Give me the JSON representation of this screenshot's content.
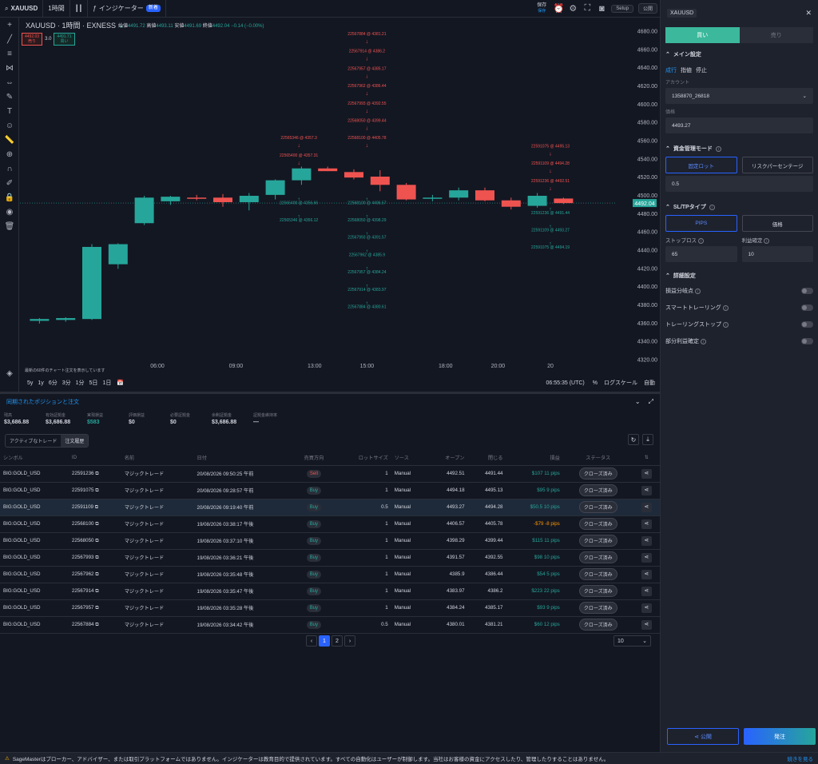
{
  "topbar": {
    "symbol": "XAUUSD",
    "interval": "1時間",
    "indicators": "インジケーター",
    "new_badge": "新着",
    "save": "保存",
    "saved": "保存",
    "setup": "Setup",
    "publish": "公開"
  },
  "chart": {
    "title": "XAUUSD · 1時間 · EXNESS",
    "ohlc": {
      "o_label": "始値",
      "o": "4491.72",
      "h_label": "高値",
      "h": "4493.11",
      "l_label": "安値",
      "l": "4491.69",
      "c_label": "終値",
      "c": "4492.04",
      "chg": "−0.14 (−0.00%)"
    },
    "sell_price": "4492.03",
    "sell_label": "売り",
    "qty": "3.0",
    "buy_price": "4491.71",
    "buy_label": "買い",
    "current_price": "4492.04",
    "show_orders_note": "最新の60件のチャート注文を表示しています",
    "timeframes": [
      "5y",
      "1y",
      "6分",
      "3分",
      "1分",
      "5日",
      "1日"
    ],
    "clock": "06:55:35 (UTC)",
    "pct": "%",
    "log": "ログスケール",
    "auto": "自動",
    "colors": {
      "up": "#26a69a",
      "down": "#ef5350"
    },
    "chart_data": {
      "type": "candlestick",
      "ylim": [
        4310,
        4690
      ],
      "yticks": [
        "4680.00",
        "4660.00",
        "4640.00",
        "4620.00",
        "4600.00",
        "4580.00",
        "4560.00",
        "4540.00",
        "4520.00",
        "4500.00",
        "4480.00",
        "4460.00",
        "4440.00",
        "4420.00",
        "4400.00",
        "4380.00",
        "4360.00",
        "4340.00",
        "4320.00"
      ],
      "xticks": [
        {
          "i": 4.5,
          "label": "06:00"
        },
        {
          "i": 7.5,
          "label": "09:00"
        },
        {
          "i": 10.5,
          "label": "13:00"
        },
        {
          "i": 12.5,
          "label": "15:00"
        },
        {
          "i": 15.5,
          "label": "18:00"
        },
        {
          "i": 17.5,
          "label": "20:00"
        },
        {
          "i": 19.5,
          "label": "20"
        }
      ],
      "candles": [
        {
          "o": 4363,
          "h": 4366,
          "l": 4360,
          "c": 4365
        },
        {
          "o": 4364,
          "h": 4367,
          "l": 4362,
          "c": 4366
        },
        {
          "o": 4365,
          "h": 4447,
          "l": 4364,
          "c": 4444
        },
        {
          "o": 4425,
          "h": 4448,
          "l": 4420,
          "c": 4447
        },
        {
          "o": 4470,
          "h": 4500,
          "l": 4468,
          "c": 4498
        },
        {
          "o": 4494,
          "h": 4500,
          "l": 4490,
          "c": 4499
        },
        {
          "o": 4498,
          "h": 4501,
          "l": 4495,
          "c": 4497
        },
        {
          "o": 4498,
          "h": 4502,
          "l": 4488,
          "c": 4493
        },
        {
          "o": 4493,
          "h": 4503,
          "l": 4484,
          "c": 4500
        },
        {
          "o": 4501,
          "h": 4518,
          "l": 4496,
          "c": 4517
        },
        {
          "o": 4517,
          "h": 4532,
          "l": 4512,
          "c": 4530
        },
        {
          "o": 4530,
          "h": 4532,
          "l": 4527,
          "c": 4527
        },
        {
          "o": 4526,
          "h": 4529,
          "l": 4518,
          "c": 4520
        },
        {
          "o": 4521,
          "h": 4528,
          "l": 4505,
          "c": 4512
        },
        {
          "o": 4512,
          "h": 4514,
          "l": 4495,
          "c": 4496
        },
        {
          "o": 4497,
          "h": 4501,
          "l": 4494,
          "c": 4498
        },
        {
          "o": 4498,
          "h": 4509,
          "l": 4495,
          "c": 4506
        },
        {
          "o": 4506,
          "h": 4509,
          "l": 4494,
          "c": 4495
        },
        {
          "o": 4495,
          "h": 4498,
          "l": 4485,
          "c": 4488
        },
        {
          "o": 4489,
          "h": 4503,
          "l": 4487,
          "c": 4500
        },
        {
          "o": 4497,
          "h": 4498,
          "l": 4491,
          "c": 4492
        }
      ],
      "trade_markers": [
        {
          "i": 9.9,
          "text": "22565346 @ 4357.3",
          "side": "sell",
          "price": 4562
        },
        {
          "i": 9.9,
          "text": "22565400 @ 4357.31",
          "side": "sell",
          "price": 4543
        },
        {
          "i": 9.9,
          "text": "22565400 @ 4356.66",
          "side": "buy",
          "price": 4491
        },
        {
          "i": 9.9,
          "text": "22565346 @ 4356.12",
          "side": "buy",
          "price": 4472
        },
        {
          "i": 12.5,
          "text": "22567884 @ 4381.21",
          "side": "sell",
          "price": 4676
        },
        {
          "i": 12.5,
          "text": "22567914 @ 4386.2",
          "side": "sell",
          "price": 4657
        },
        {
          "i": 12.5,
          "text": "22567957 @ 4385.17",
          "side": "sell",
          "price": 4638
        },
        {
          "i": 12.5,
          "text": "22567962 @ 4386.44",
          "side": "sell",
          "price": 4619
        },
        {
          "i": 12.5,
          "text": "22567993 @ 4392.55",
          "side": "sell",
          "price": 4600
        },
        {
          "i": 12.5,
          "text": "22568050 @ 4399.44",
          "side": "sell",
          "price": 4581
        },
        {
          "i": 12.5,
          "text": "22568100 @ 4405.78",
          "side": "sell",
          "price": 4562
        },
        {
          "i": 12.5,
          "text": "22568100 @ 4406.57",
          "side": "buy",
          "price": 4491
        },
        {
          "i": 12.5,
          "text": "22568050 @ 4398.29",
          "side": "buy",
          "price": 4472
        },
        {
          "i": 12.5,
          "text": "22567993 @ 4391.57",
          "side": "buy",
          "price": 4453
        },
        {
          "i": 12.5,
          "text": "22567962 @ 4385.9",
          "side": "buy",
          "price": 4434
        },
        {
          "i": 12.5,
          "text": "22567957 @ 4384.24",
          "side": "buy",
          "price": 4415
        },
        {
          "i": 12.5,
          "text": "22567914 @ 4383.97",
          "side": "buy",
          "price": 4396
        },
        {
          "i": 12.5,
          "text": "22567884 @ 4380.61",
          "side": "buy",
          "price": 4377
        },
        {
          "i": 19.5,
          "text": "22591075 @ 4495.13",
          "side": "sell",
          "price": 4553
        },
        {
          "i": 19.5,
          "text": "22591109 @ 4494.28",
          "side": "sell",
          "price": 4534
        },
        {
          "i": 19.5,
          "text": "22591236 @ 4492.51",
          "side": "sell",
          "price": 4515
        },
        {
          "i": 19.5,
          "text": "22591236 @ 4491.44",
          "side": "buy",
          "price": 4480
        },
        {
          "i": 19.5,
          "text": "22591109 @ 4493.27",
          "side": "buy",
          "price": 4461
        },
        {
          "i": 19.5,
          "text": "22591075 @ 4494.19",
          "side": "buy",
          "price": 4442
        }
      ]
    }
  },
  "panel": {
    "title": "同期されたポジションと注文",
    "stats": [
      {
        "label": "残高",
        "value": "$3,686.88"
      },
      {
        "label": "有効証拠金",
        "value": "$3,686.88"
      },
      {
        "label": "実現損益",
        "value": "$583"
      },
      {
        "label": "評価損益",
        "value": "$0"
      },
      {
        "label": "必要証拠金",
        "value": "$0"
      },
      {
        "label": "余剰証拠金",
        "value": "$3,686.88"
      },
      {
        "label": "証拠金維持率",
        "value": "—"
      }
    ],
    "tabs": [
      "アクティブなトレード",
      "注文履歴"
    ],
    "columns": [
      "シンボル",
      "ID",
      "名前",
      "日付",
      "売買方向",
      "ロットサイズ",
      "ソース",
      "オープン",
      "閉じる",
      "損益",
      "ステータス"
    ],
    "rows": [
      {
        "symbol": "BIG:GOLD_USD",
        "id": "22591236",
        "name": "マジックトレード",
        "date": "20/08/2026 09:50:25 午前",
        "dir": "Sell",
        "lot": "1",
        "src": "Manual",
        "open": "4492.51",
        "close": "4491.44",
        "pnl": "$107 11 pips",
        "neg": false,
        "status": "クローズ済み"
      },
      {
        "symbol": "BIG:GOLD_USD",
        "id": "22591075",
        "name": "マジックトレード",
        "date": "20/08/2026 09:28:57 午前",
        "dir": "Buy",
        "lot": "1",
        "src": "Manual",
        "open": "4494.18",
        "close": "4495.13",
        "pnl": "$95 9 pips",
        "neg": false,
        "status": "クローズ済み"
      },
      {
        "symbol": "BIG:GOLD_USD",
        "id": "22591109",
        "name": "マジックトレード",
        "date": "20/08/2026 09:19:40 午前",
        "dir": "Buy",
        "lot": "0.5",
        "src": "Manual",
        "open": "4493.27",
        "close": "4494.28",
        "pnl": "$50.5 10 pips",
        "neg": false,
        "status": "クローズ済み",
        "hl": true
      },
      {
        "symbol": "BIG:GOLD_USD",
        "id": "22568100",
        "name": "マジックトレード",
        "date": "19/08/2026 03:38:17 午後",
        "dir": "Buy",
        "lot": "1",
        "src": "Manual",
        "open": "4406.57",
        "close": "4405.78",
        "pnl": "-$79 -8 pips",
        "neg": true,
        "status": "クローズ済み"
      },
      {
        "symbol": "BIG:GOLD_USD",
        "id": "22568050",
        "name": "マジックトレード",
        "date": "19/08/2026 03:37:10 午後",
        "dir": "Buy",
        "lot": "1",
        "src": "Manual",
        "open": "4398.29",
        "close": "4399.44",
        "pnl": "$115 11 pips",
        "neg": false,
        "status": "クローズ済み"
      },
      {
        "symbol": "BIG:GOLD_USD",
        "id": "22567993",
        "name": "マジックトレード",
        "date": "19/08/2026 03:36:21 午後",
        "dir": "Buy",
        "lot": "1",
        "src": "Manual",
        "open": "4391.57",
        "close": "4392.55",
        "pnl": "$98 10 pips",
        "neg": false,
        "status": "クローズ済み"
      },
      {
        "symbol": "BIG:GOLD_USD",
        "id": "22567962",
        "name": "マジックトレード",
        "date": "19/08/2026 03:35:48 午後",
        "dir": "Buy",
        "lot": "1",
        "src": "Manual",
        "open": "4385.9",
        "close": "4386.44",
        "pnl": "$54 5 pips",
        "neg": false,
        "status": "クローズ済み"
      },
      {
        "symbol": "BIG:GOLD_USD",
        "id": "22567914",
        "name": "マジックトレード",
        "date": "19/08/2026 03:35:47 午後",
        "dir": "Buy",
        "lot": "1",
        "src": "Manual",
        "open": "4383.97",
        "close": "4386.2",
        "pnl": "$223 22 pips",
        "neg": false,
        "status": "クローズ済み"
      },
      {
        "symbol": "BIG:GOLD_USD",
        "id": "22567957",
        "name": "マジックトレード",
        "date": "19/08/2026 03:35:28 午後",
        "dir": "Buy",
        "lot": "1",
        "src": "Manual",
        "open": "4384.24",
        "close": "4385.17",
        "pnl": "$93 9 pips",
        "neg": false,
        "status": "クローズ済み"
      },
      {
        "symbol": "BIG:GOLD_USD",
        "id": "22567884",
        "name": "マジックトレード",
        "date": "19/08/2026 03:34:42 午後",
        "dir": "Buy",
        "lot": "0.5",
        "src": "Manual",
        "open": "4380.01",
        "close": "4381.21",
        "pnl": "$60 12 pips",
        "neg": false,
        "status": "クローズ済み"
      }
    ],
    "pages": [
      "1",
      "2"
    ],
    "page_size": "10"
  },
  "order": {
    "symbol": "XAUUSD",
    "buy": "買い",
    "sell": "売り",
    "main_settings": "メイン設定",
    "types": [
      "成行",
      "指値",
      "停止"
    ],
    "account_label": "アカウント",
    "account": "1358870_26818",
    "price_label": "価格",
    "price": "4493.27",
    "mm_title": "資金管理モード",
    "mm_fixed": "固定ロット",
    "mm_risk": "リスクパーセンテージ",
    "lot": "0.5",
    "sltp_title": "SL/TPタイプ",
    "sltp_pips": "PIPS",
    "sltp_price": "価格",
    "sl_label": "ストップロス",
    "sl": "65",
    "tp_label": "利益確定",
    "tp": "10",
    "adv_title": "詳細設定",
    "toggles": [
      "損益分岐点",
      "スマートトレーリング",
      "トレーリングストップ",
      "部分利益確定"
    ],
    "publish": "公開",
    "submit": "発注"
  },
  "footer": {
    "text": "SageMasterはブローカー、アドバイザー、または取引プラットフォームではありません。インジケーターは教育目的で提供されています。すべての自動化はユーザーが制御します。当社はお客様の資金にアクセスしたり、管理したりすることはありません。",
    "more": "続きを見る"
  }
}
